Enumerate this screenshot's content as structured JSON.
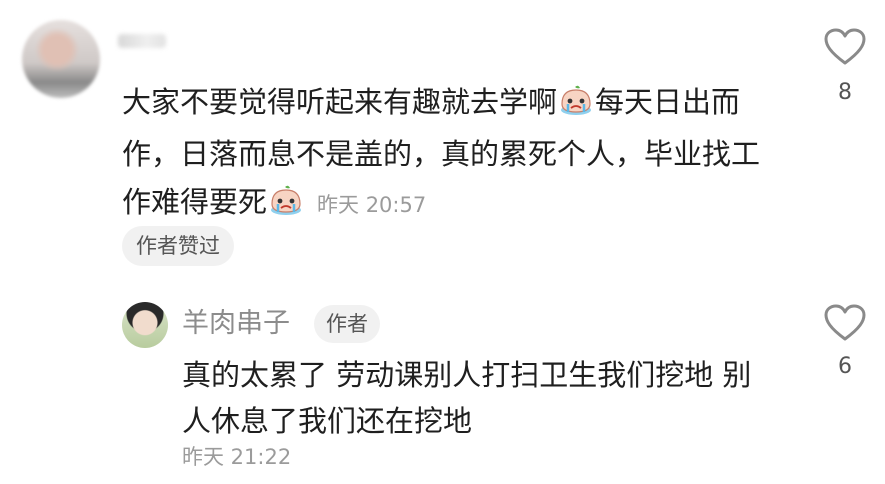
{
  "comment": {
    "text_a": "大家不要觉得听起来有趣就去学啊",
    "text_b": "每天日出而作，日落而息不是盖的，真的累死个人，毕业找工作难得要死",
    "emoji_name": "crying-face-emoji",
    "time": "昨天 20:57",
    "liked_badge": "作者赞过",
    "like_count": "8"
  },
  "reply": {
    "username": "羊肉串子",
    "author_badge": "作者",
    "text": "真的太累了 劳动课别人打扫卫生我们挖地 别人休息了我们还在挖地",
    "time": "昨天 21:22",
    "like_count": "6"
  },
  "icons": {
    "like": "heart-outline-icon"
  }
}
